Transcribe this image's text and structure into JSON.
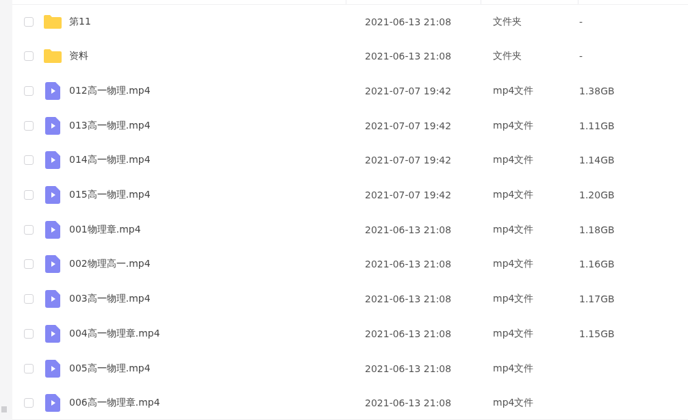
{
  "files": [
    {
      "kind": "folder",
      "name": "第11",
      "modified": "2021-06-13 21:08",
      "type": "文件夹",
      "size": "-",
      "checked": false
    },
    {
      "kind": "folder",
      "name": "资料",
      "modified": "2021-06-13 21:08",
      "type": "文件夹",
      "size": "-",
      "checked": false
    },
    {
      "kind": "video",
      "name": "012高一物理.mp4",
      "modified": "2021-07-07 19:42",
      "type": "mp4文件",
      "size": "1.38GB",
      "checked": false
    },
    {
      "kind": "video",
      "name": "013高一物理.mp4",
      "modified": "2021-07-07 19:42",
      "type": "mp4文件",
      "size": "1.11GB",
      "checked": false
    },
    {
      "kind": "video",
      "name": "014高一物理.mp4",
      "modified": "2021-07-07 19:42",
      "type": "mp4文件",
      "size": "1.14GB",
      "checked": false
    },
    {
      "kind": "video",
      "name": "015高一物理.mp4",
      "modified": "2021-07-07 19:42",
      "type": "mp4文件",
      "size": "1.20GB",
      "checked": false
    },
    {
      "kind": "video",
      "name": "001物理章.mp4",
      "modified": "2021-06-13 21:08",
      "type": "mp4文件",
      "size": "1.18GB",
      "checked": false
    },
    {
      "kind": "video",
      "name": "002物理高一.mp4",
      "modified": "2021-06-13 21:08",
      "type": "mp4文件",
      "size": "1.16GB",
      "checked": false
    },
    {
      "kind": "video",
      "name": "003高一物理.mp4",
      "modified": "2021-06-13 21:08",
      "type": "mp4文件",
      "size": "1.17GB",
      "checked": false
    },
    {
      "kind": "video",
      "name": "004高一物理章.mp4",
      "modified": "2021-06-13 21:08",
      "type": "mp4文件",
      "size": "1.15GB",
      "checked": false
    },
    {
      "kind": "video",
      "name": "005高一物理.mp4",
      "modified": "2021-06-13 21:08",
      "type": "mp4文件",
      "checked": false
    },
    {
      "kind": "video",
      "name": "006高一物理章.mp4",
      "modified": "2021-06-13 21:08",
      "type": "mp4文件",
      "checked": false
    }
  ]
}
